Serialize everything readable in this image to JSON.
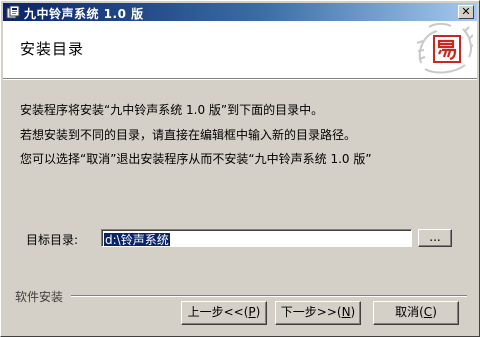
{
  "window": {
    "title": "九中铃声系统 1.0 版",
    "close_glyph": "✕"
  },
  "header": {
    "title": "安装目录"
  },
  "body": {
    "line1": "安装程序将安装“九中铃声系统 1.0 版”到下面的目录中。",
    "line2": "若想安装到不同的目录，请直接在编辑框中输入新的目录路径。",
    "line3": "您可以选择“取消”退出安装程序从而不安装“九中铃声系统 1.0 版”"
  },
  "target_dir": {
    "label": "目标目录:",
    "value": "d:\\铃声系统",
    "browse_label": "..."
  },
  "footer": {
    "group_label": "软件安装",
    "back_label": "上一步<<(",
    "back_key": "P",
    "back_suffix": ")",
    "next_label": "下一步>>(",
    "next_key": "N",
    "next_suffix": ")",
    "cancel_label": "取消(",
    "cancel_key": "C",
    "cancel_suffix": ")"
  },
  "colors": {
    "titlebar_start": "#0a246a",
    "titlebar_end": "#a6caf0",
    "face": "#d4d0c8",
    "selection": "#0a246a",
    "logo_red": "#c8281e"
  },
  "icons": {
    "app": "installer-app-icon",
    "logo": "dragon-seal-logo"
  }
}
